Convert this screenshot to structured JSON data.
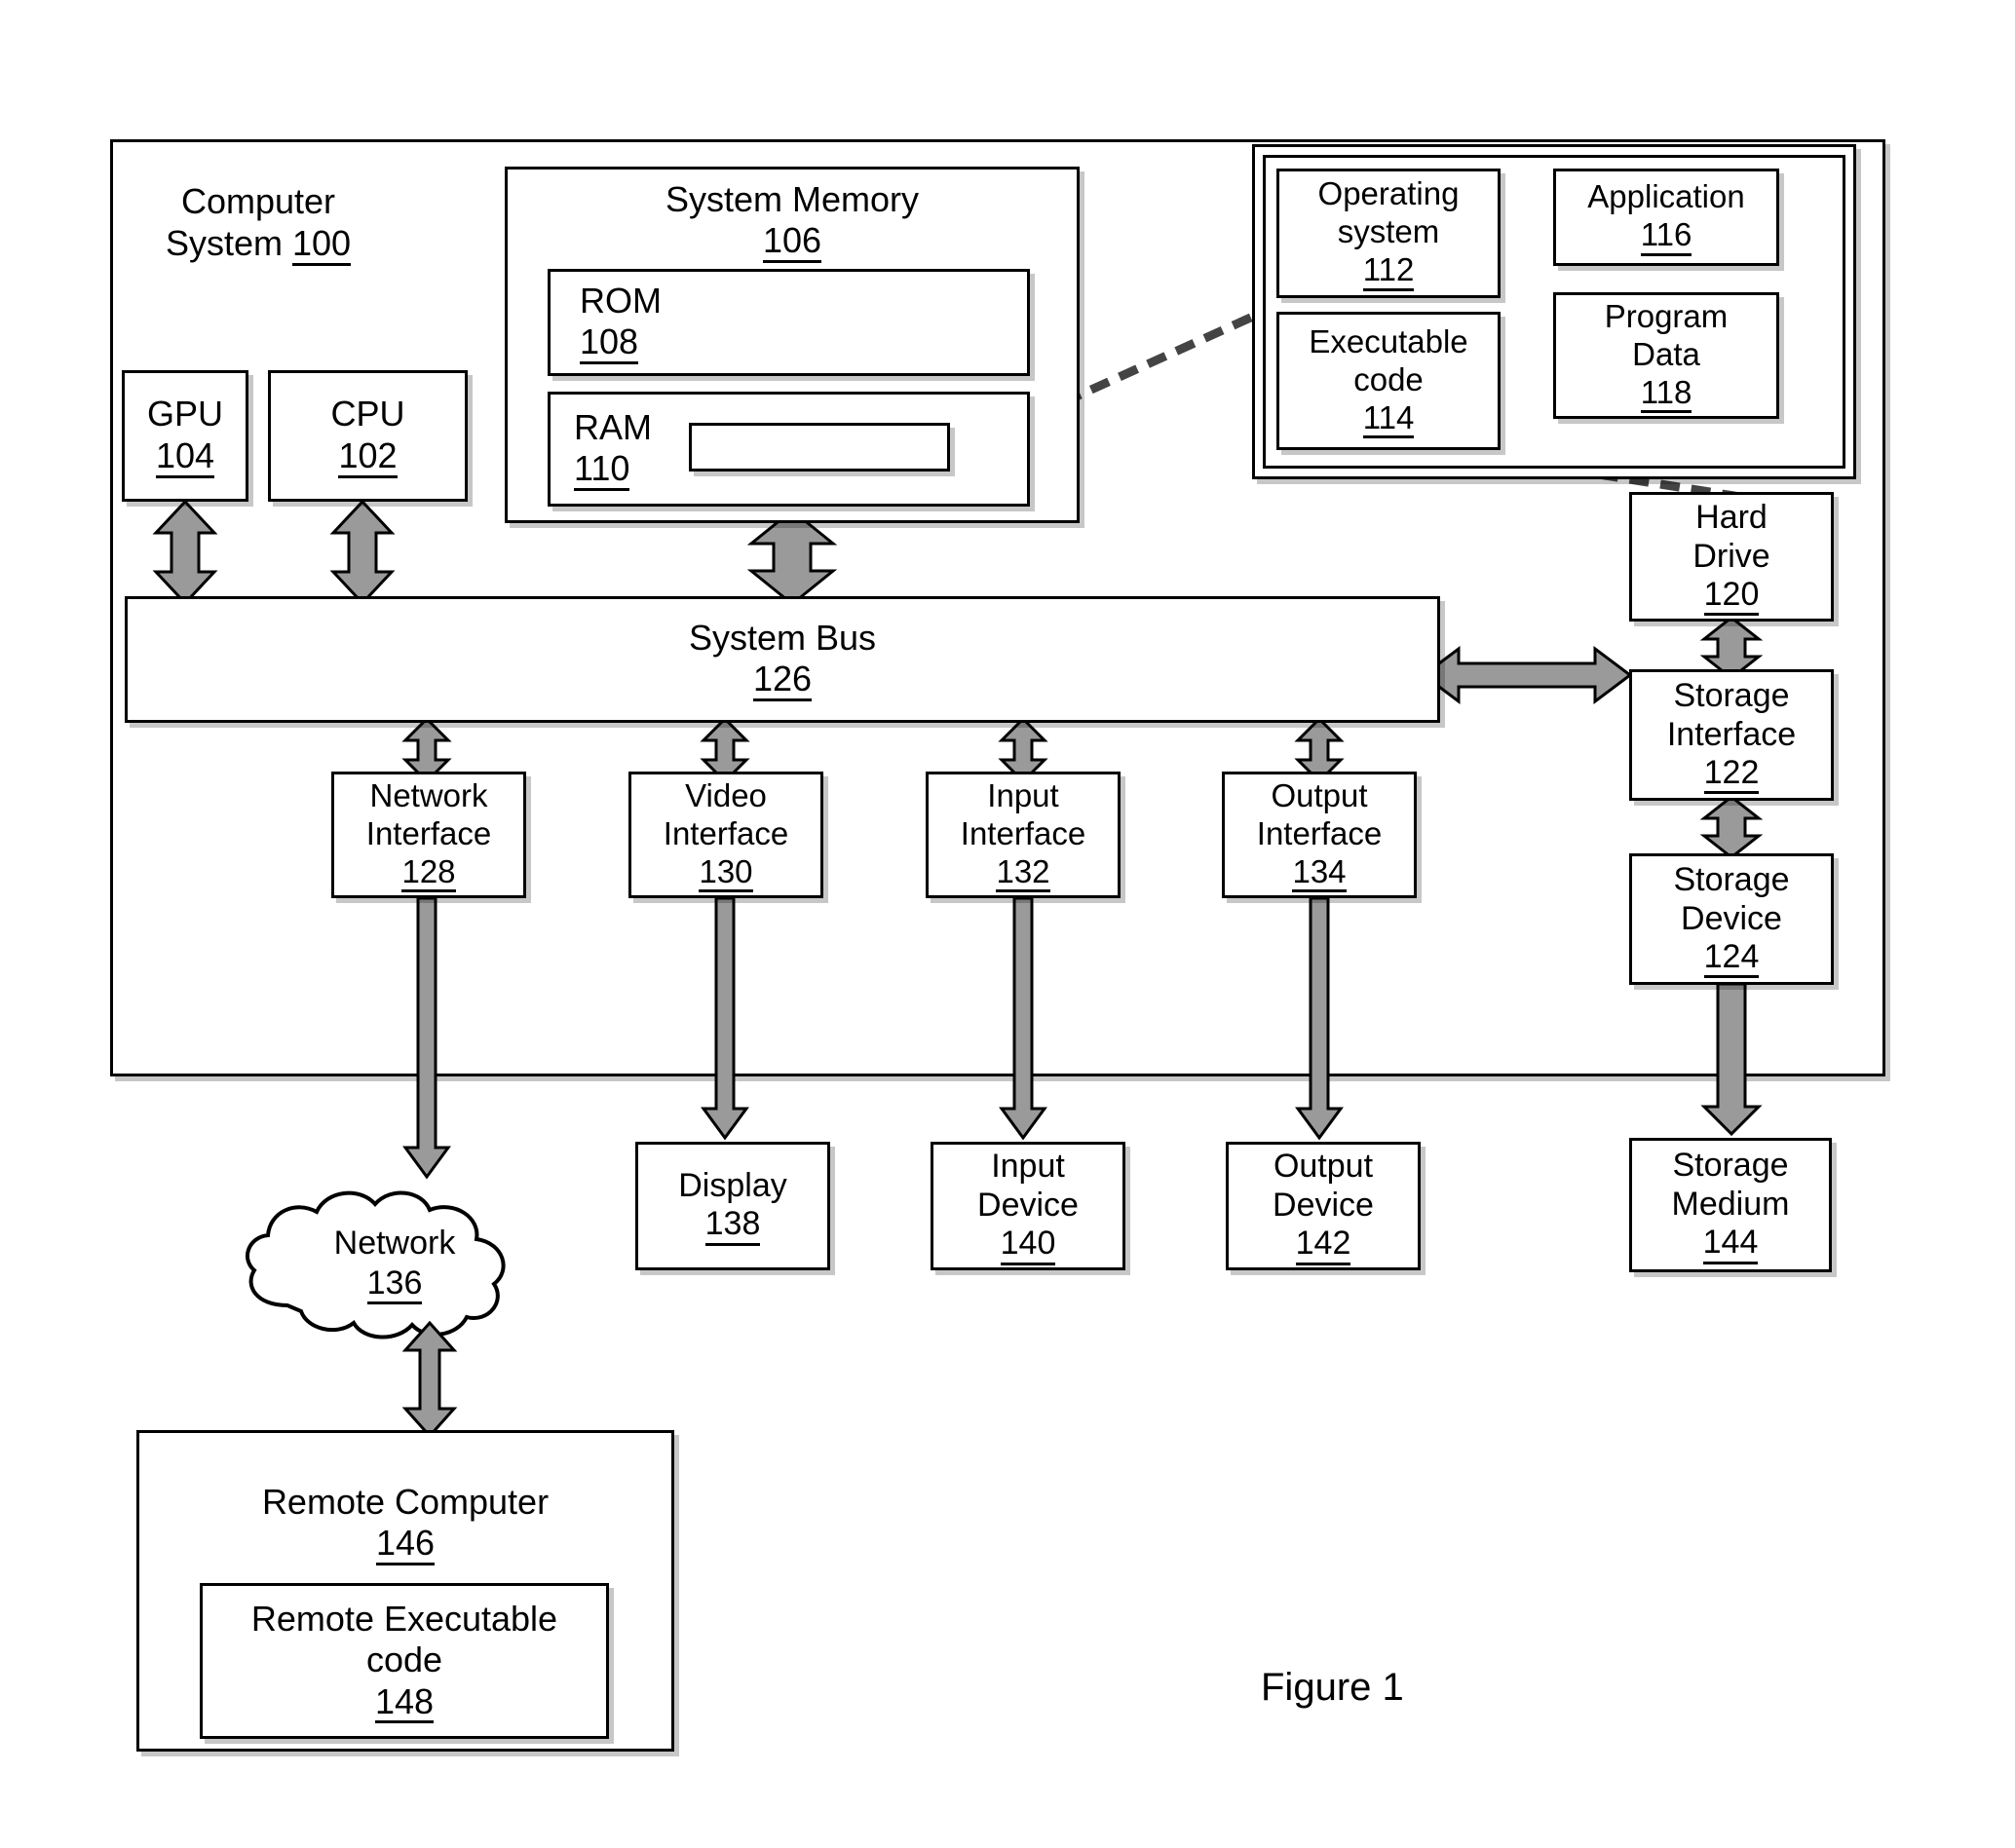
{
  "figure": {
    "caption": "Figure 1"
  },
  "computer_system": {
    "label_line1": "Computer",
    "label_line2": "System",
    "ref": "100"
  },
  "processors": [
    {
      "name": "gpu",
      "label": "GPU",
      "ref": "104"
    },
    {
      "name": "cpu",
      "label": "CPU",
      "ref": "102"
    }
  ],
  "system_memory": {
    "label": "System Memory",
    "ref": "106",
    "rom": {
      "label": "ROM",
      "ref": "108"
    },
    "ram": {
      "label": "RAM",
      "ref": "110"
    }
  },
  "software_container": {
    "operating_system": {
      "label_line1": "Operating",
      "label_line2": "system",
      "ref": "112"
    },
    "executable_code": {
      "label_line1": "Executable",
      "label_line2": "code",
      "ref": "114"
    },
    "application": {
      "label": "Application",
      "ref": "116"
    },
    "program_data": {
      "label_line1": "Program",
      "label_line2": "Data",
      "ref": "118"
    }
  },
  "system_bus": {
    "label": "System Bus",
    "ref": "126"
  },
  "storage_chain": [
    {
      "name": "hard-drive",
      "label_line1": "Hard",
      "label_line2": "Drive",
      "ref": "120"
    },
    {
      "name": "storage-interface",
      "label_line1": "Storage",
      "label_line2": "Interface",
      "ref": "122"
    },
    {
      "name": "storage-device",
      "label_line1": "Storage",
      "label_line2": "Device",
      "ref": "124"
    }
  ],
  "interfaces": [
    {
      "name": "network-interface",
      "label_line1": "Network",
      "label_line2": "Interface",
      "ref": "128"
    },
    {
      "name": "video-interface",
      "label_line1": "Video",
      "label_line2": "Interface",
      "ref": "130"
    },
    {
      "name": "input-interface",
      "label_line1": "Input",
      "label_line2": "Interface",
      "ref": "132"
    },
    {
      "name": "output-interface",
      "label_line1": "Output",
      "label_line2": "Interface",
      "ref": "134"
    }
  ],
  "peripherals": [
    {
      "name": "display",
      "label_line1": "Display",
      "label_line2": "",
      "ref": "138"
    },
    {
      "name": "input-device",
      "label_line1": "Input",
      "label_line2": "Device",
      "ref": "140"
    },
    {
      "name": "output-device",
      "label_line1": "Output",
      "label_line2": "Device",
      "ref": "142"
    },
    {
      "name": "storage-medium",
      "label_line1": "Storage",
      "label_line2": "Medium",
      "ref": "144"
    }
  ],
  "network": {
    "label": "Network",
    "ref": "136"
  },
  "remote": {
    "computer": {
      "label": "Remote Computer",
      "ref": "146"
    },
    "executable_code": {
      "label_line1": "Remote Executable",
      "label_line2": "code",
      "ref": "148"
    }
  },
  "colors": {
    "stroke": "#000000",
    "arrow_fill": "#9a9a9a",
    "background": "#ffffff"
  }
}
